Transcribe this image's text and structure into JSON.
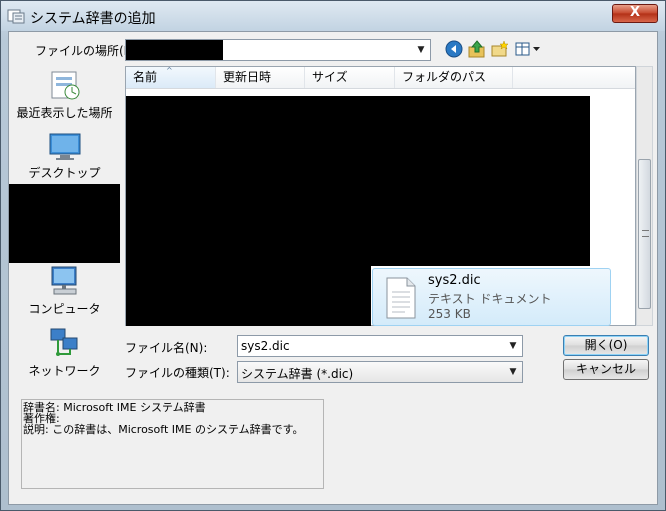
{
  "window": {
    "title": "システム辞書の追加",
    "close_label": "X"
  },
  "location": {
    "label": "ファイルの場所(I):",
    "value": ""
  },
  "places": [
    {
      "label": "最近表示した場所",
      "icon": "recent-places-icon"
    },
    {
      "label": "デスクトップ",
      "icon": "desktop-icon"
    },
    {
      "label": "",
      "icon": "redacted"
    },
    {
      "label": "コンピュータ",
      "icon": "computer-icon"
    },
    {
      "label": "ネットワーク",
      "icon": "network-icon"
    }
  ],
  "columns": [
    "名前",
    "更新日時",
    "サイズ",
    "フォルダのパス"
  ],
  "file": {
    "name": "sys2.dic",
    "type": "テキスト ドキュメント",
    "size": "253 KB"
  },
  "filename": {
    "label": "ファイル名(N):",
    "value": "sys2.dic"
  },
  "filetype": {
    "label": "ファイルの種類(T):",
    "value": "システム辞書 (*.dic)"
  },
  "buttons": {
    "open": "開く(O)",
    "cancel": "キャンセル"
  },
  "info": {
    "name_line": "辞書名: Microsoft IME システム辞書",
    "author_line": "著作権:",
    "desc_line": "説明: この辞書は、Microsoft IME のシステム辞書です。"
  },
  "colors": {
    "selection": "#d4ebfa",
    "accent": "#3c7fb1"
  }
}
